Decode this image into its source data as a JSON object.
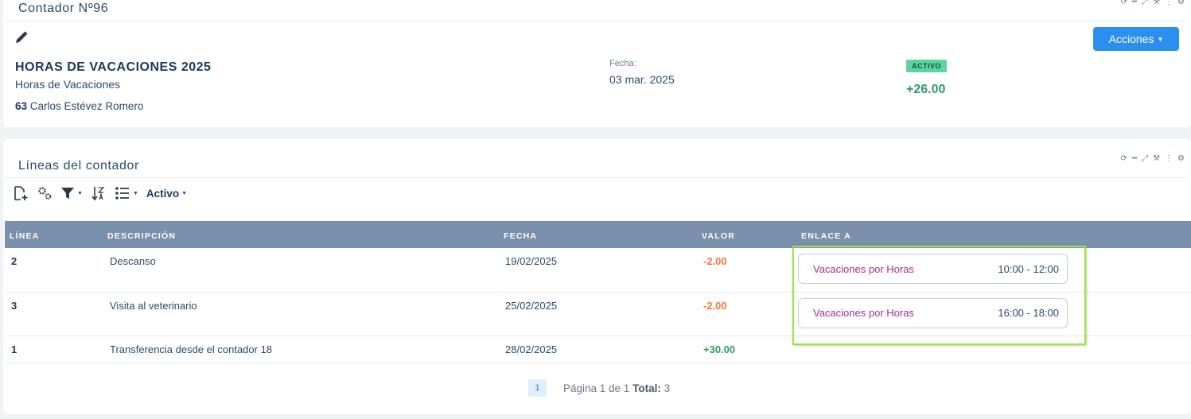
{
  "header": {
    "title": "Contador Nº96",
    "actions_label": "Acciones",
    "record_title": "HORAS DE VACACIONES 2025",
    "record_subtitle": "Horas de Vacaciones",
    "employee_id": "63",
    "employee_name": "Carlos Estévez Romero",
    "date_label": "Fecha:",
    "date_value": "03 mar. 2025",
    "status_badge": "ACTIVO",
    "total": "+26.00"
  },
  "lines_panel": {
    "title": "Líneas del contador",
    "filter_label": "Activo",
    "columns": [
      "LÍNEA",
      "DESCRIPCIÓN",
      "FECHA",
      "VALOR",
      "ENLACE A"
    ],
    "rows": [
      {
        "line": "2",
        "description": "Descanso",
        "date": "19/02/2025",
        "value": "-2.00",
        "link_name": "Vacaciones por Horas",
        "link_time": "10:00 - 12:00"
      },
      {
        "line": "3",
        "description": "Visita al veterinario",
        "date": "25/02/2025",
        "value": "-2.00",
        "link_name": "Vacaciones por Horas",
        "link_time": "16:00 - 18:00"
      },
      {
        "line": "1",
        "description": "Transferencia desde el contador 18",
        "date": "28/02/2025",
        "value": "+30.00"
      }
    ],
    "pagination": {
      "current_page": "1",
      "text": "Página 1 de 1",
      "total_label": "Total:",
      "total_value": "3"
    }
  },
  "colors": {
    "accent": "#2b8ff0",
    "table_header": "#7a90ad",
    "negative": "#f0783c",
    "positive": "#2e9b64",
    "badge": "#5dd39e",
    "highlight": "#9fe04a"
  }
}
